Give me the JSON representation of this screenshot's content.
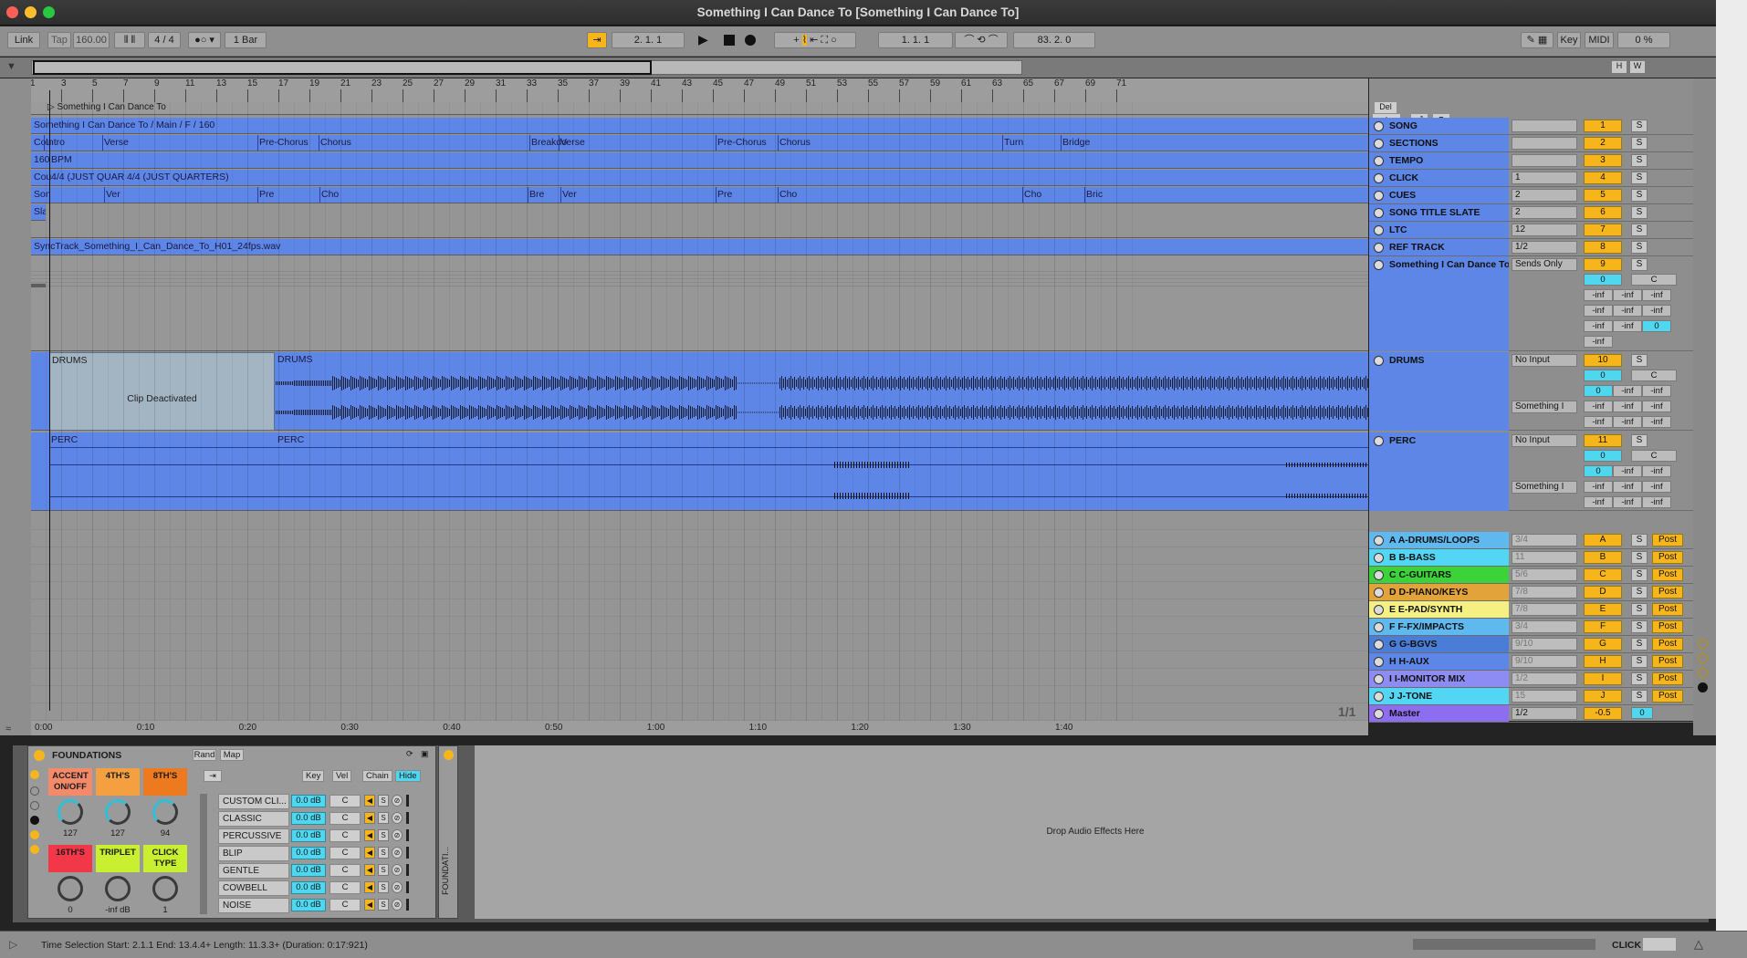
{
  "window": {
    "title": "Something I Can Dance To  [Something I Can Dance To]"
  },
  "control_bar": {
    "link": "Link",
    "tap": "Tap",
    "tempo": "160.00",
    "signature": "4 / 4",
    "metro": "1 Bar",
    "position": "2.   1.   1",
    "loop_start": "1.   1.   1",
    "loop_length": "83.   2.   0",
    "key": "Key",
    "midi": "MIDI",
    "cpu": "0 %",
    "h": "H",
    "w": "W"
  },
  "ruler": {
    "bars": [
      "1",
      "3",
      "5",
      "7",
      "9",
      "11",
      "13",
      "15",
      "17",
      "19",
      "21",
      "23",
      "25",
      "27",
      "29",
      "31",
      "33",
      "35",
      "37",
      "39",
      "41",
      "43",
      "45",
      "47",
      "49",
      "51",
      "53",
      "55",
      "57",
      "59",
      "61",
      "63",
      "65",
      "67",
      "69",
      "71"
    ],
    "times": [
      "0:00",
      "0:10",
      "0:20",
      "0:30",
      "0:40",
      "0:50",
      "1:00",
      "1:10",
      "1:20",
      "1:30",
      "1:40"
    ],
    "page": "1/1"
  },
  "arrangement": {
    "song_clip": "Something I Can Dance To",
    "song_row": "Something I Can Dance To / Main / F / 160",
    "sections_row": {
      "first": "Cou",
      "labels": [
        "Intro",
        "Verse",
        "Pre-Chorus",
        "Chorus",
        "Breakdo",
        "Verse",
        "Pre-Chorus",
        "Chorus",
        "Turn",
        "Bridge"
      ]
    },
    "tempo_row": {
      "first": "160",
      "label": "BPM"
    },
    "click_row": {
      "first": "Cou",
      "labels": [
        "4/4 (JUST QUAR",
        "4/4 (JUST QUARTERS)"
      ]
    },
    "cues_row": {
      "first": "Son",
      "labels": [
        "Ver",
        "Pre",
        "Cho",
        "Bre",
        "Ver",
        "Pre",
        "Cho",
        "Cho",
        "Bric"
      ]
    },
    "slate_row": "Slat",
    "ref_row": "SyncTrack_Something_I_Can_Dance_To_H01_24fps.wav",
    "drums_clip_deact_title": "DRUMS",
    "drums_clip_deact": "Clip Deactivated",
    "drums_clip": "DRUMS",
    "perc_clip_deact": "PERC",
    "perc_clip": "PERC"
  },
  "mixer": {
    "del": "Del",
    "tracks": [
      {
        "name": "SONG",
        "io": "",
        "num": "1",
        "s": "S"
      },
      {
        "name": "SECTIONS",
        "io": "",
        "num": "2",
        "s": "S"
      },
      {
        "name": "TEMPO",
        "io": "",
        "num": "3",
        "s": "S"
      },
      {
        "name": "CLICK",
        "io": "1",
        "num": "4",
        "s": "S"
      },
      {
        "name": "CUES",
        "io": "2",
        "num": "5",
        "s": "S"
      },
      {
        "name": "SONG TITLE SLATE",
        "io": "2",
        "num": "6",
        "s": "S"
      },
      {
        "name": "LTC",
        "io": "12",
        "num": "7",
        "s": "S"
      },
      {
        "name": "REF TRACK",
        "io": "1/2",
        "num": "8",
        "s": "S"
      }
    ],
    "group": {
      "name": "Something I Can Dance To",
      "io": "Sends Only",
      "num": "9",
      "s": "S",
      "vol": "0",
      "pan": "C",
      "sends": [
        "-inf",
        "-inf",
        "-inf",
        "-inf",
        "-inf",
        "-inf",
        "-inf",
        "-inf",
        "0",
        "-inf"
      ]
    },
    "drums": {
      "name": "DRUMS",
      "io": "No Input",
      "num": "10",
      "s": "S",
      "vol": "0",
      "pan": "C",
      "out": "Something I",
      "sends": [
        "0",
        "-inf",
        "-inf",
        "-inf",
        "-inf",
        "-inf",
        "-inf",
        "-inf",
        "-inf"
      ]
    },
    "perc": {
      "name": "PERC",
      "io": "No Input",
      "num": "11",
      "s": "S",
      "vol": "0",
      "pan": "C",
      "out": "Something I",
      "sends": [
        "0",
        "-inf",
        "-inf",
        "-inf",
        "-inf",
        "-inf",
        "-inf",
        "-inf",
        "-inf"
      ]
    },
    "returns": [
      {
        "name": "A A-DRUMS/LOOPS",
        "io": "3/4",
        "letter": "A",
        "color": "#5fb8ee"
      },
      {
        "name": "B B-BASS",
        "io": "11",
        "letter": "B",
        "color": "#52d6f4"
      },
      {
        "name": "C C-GUITARS",
        "io": "5/6",
        "letter": "C",
        "color": "#3cd23a"
      },
      {
        "name": "D D-PIANO/KEYS",
        "io": "7/8",
        "letter": "D",
        "color": "#e2a43a"
      },
      {
        "name": "E E-PAD/SYNTH",
        "io": "7/8",
        "letter": "E",
        "color": "#f4f082"
      },
      {
        "name": "F F-FX/IMPACTS",
        "io": "3/4",
        "letter": "F",
        "color": "#5fb8ee"
      },
      {
        "name": "G G-BGVS",
        "io": "9/10",
        "letter": "G",
        "color": "#4a7dd8"
      },
      {
        "name": "H H-AUX",
        "io": "9/10",
        "letter": "H",
        "color": "#5d86e6"
      },
      {
        "name": "I I-MONITOR MIX",
        "io": "1/2",
        "letter": "I",
        "color": "#8c8cf4"
      },
      {
        "name": "J J-TONE",
        "io": "15",
        "letter": "J",
        "color": "#52d6f4"
      }
    ],
    "post": "Post",
    "master": {
      "name": "Master",
      "io": "1/2",
      "vol": "-0.5",
      "pan": "0"
    }
  },
  "device": {
    "name": "FOUNDATIONS",
    "rand": "Rand",
    "map": "Map",
    "pads": [
      {
        "label": "ACCENT ON/OFF",
        "value": "127",
        "color": "#f48a6a"
      },
      {
        "label": "4TH'S",
        "value": "127",
        "color": "#f4a040"
      },
      {
        "label": "8TH'S",
        "value": "94",
        "color": "#ee7a20"
      },
      {
        "label": "16TH'S",
        "value": "0",
        "color": "#f23848"
      },
      {
        "label": "TRIPLET",
        "value": "-inf dB",
        "color": "#c8f030"
      },
      {
        "label": "CLICK TYPE",
        "value": "1",
        "color": "#c8f030"
      }
    ],
    "tabs": [
      "Key",
      "Vel",
      "Chain",
      "Hide"
    ],
    "chains": [
      {
        "name": "CUSTOM CLI...",
        "db": "0.0 dB",
        "pan": "C"
      },
      {
        "name": "CLASSIC",
        "db": "0.0 dB",
        "pan": "C"
      },
      {
        "name": "PERCUSSIVE",
        "db": "0.0 dB",
        "pan": "C"
      },
      {
        "name": "BLIP",
        "db": "0.0 dB",
        "pan": "C"
      },
      {
        "name": "GENTLE",
        "db": "0.0 dB",
        "pan": "C"
      },
      {
        "name": "COWBELL",
        "db": "0.0 dB",
        "pan": "C"
      },
      {
        "name": "NOISE",
        "db": "0.0 dB",
        "pan": "C"
      }
    ],
    "side_label": "FOUNDATI...",
    "drop": "Drop Audio Effects Here"
  },
  "status": {
    "text": "Time Selection    Start: 2.1.1    End: 13.4.4+    Length: 11.3.3+ (Duration: 0:17:921)",
    "right": "CLICK"
  }
}
